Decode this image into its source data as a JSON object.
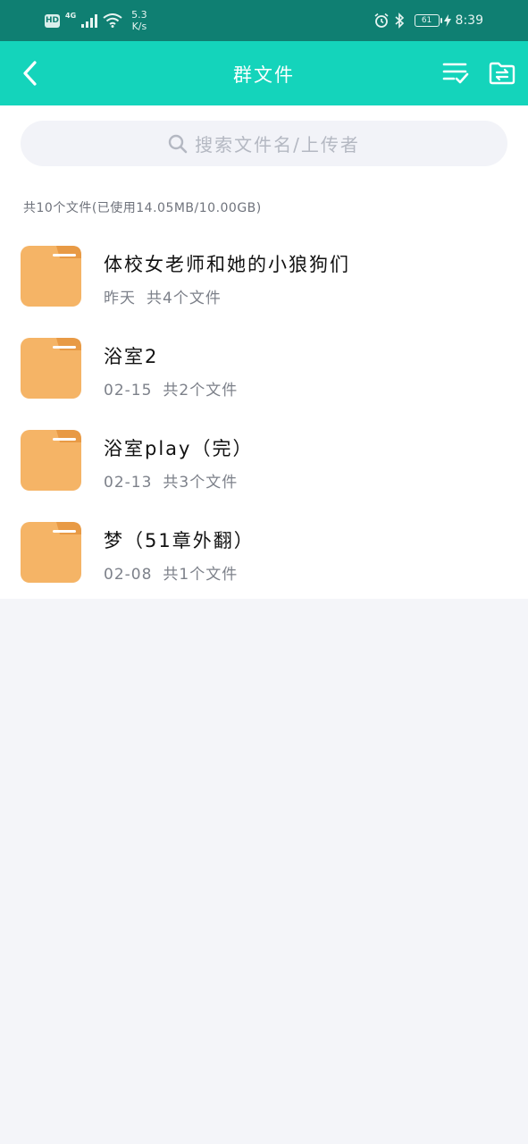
{
  "status_bar": {
    "hd": "HD",
    "network": "4G",
    "speed_value": "5.3",
    "speed_unit": "K/s",
    "battery": "61",
    "time": "8:39"
  },
  "header": {
    "title": "群文件",
    "background_color": "#14d4bb",
    "icons": [
      "back-arrow-icon",
      "multi-select-list-icon",
      "folder-transfer-icon"
    ]
  },
  "search": {
    "placeholder": "搜索文件名/上传者"
  },
  "summary": "共10个文件(已使用14.05MB/10.00GB)",
  "folders": [
    {
      "name": "体校女老师和她的小狼狗们",
      "date": "昨天",
      "count": "共4个文件"
    },
    {
      "name": "浴室2",
      "date": "02-15",
      "count": "共2个文件"
    },
    {
      "name": "浴室play（完）",
      "date": "02-13",
      "count": "共3个文件"
    },
    {
      "name": "梦（51章外翻）",
      "date": "02-08",
      "count": "共1个文件"
    }
  ],
  "colors": {
    "status_bar": "#0f7f72",
    "folder": "#f5b466",
    "page_background": "#f4f5f9"
  }
}
